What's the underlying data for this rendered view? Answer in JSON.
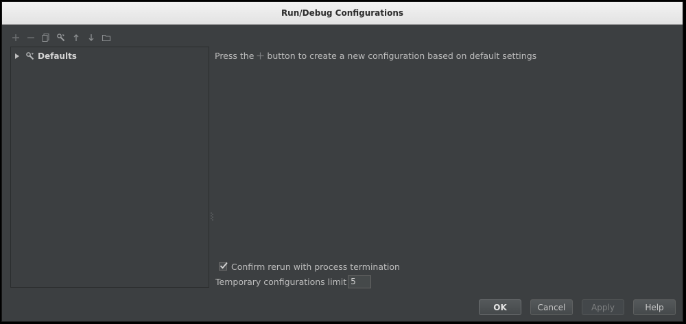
{
  "window": {
    "title": "Run/Debug Configurations"
  },
  "toolbar": {
    "items": [
      {
        "name": "add",
        "icon": "plus-icon"
      },
      {
        "name": "remove",
        "icon": "minus-icon"
      },
      {
        "name": "copy",
        "icon": "copy-icon"
      },
      {
        "name": "edit-defaults",
        "icon": "wrench-icon"
      },
      {
        "name": "move-up",
        "icon": "arrow-up-icon"
      },
      {
        "name": "move-down",
        "icon": "arrow-down-icon"
      },
      {
        "name": "folder",
        "icon": "folder-icon"
      }
    ]
  },
  "tree": {
    "items": [
      {
        "label": "Defaults",
        "icon": "wrench-icon",
        "expanded": false
      }
    ]
  },
  "main": {
    "hint_prefix": "Press the",
    "hint_suffix": "button to create a new configuration based on default settings",
    "confirm_rerun_label": "Confirm rerun with process termination",
    "confirm_rerun_checked": true,
    "temp_limit_label": "Temporary configurations limit",
    "temp_limit_value": "5"
  },
  "buttons": {
    "ok": "OK",
    "cancel": "Cancel",
    "apply": "Apply",
    "help": "Help"
  },
  "colors": {
    "background": "#3c3f41",
    "text": "#bdbdbd",
    "titlebar": "#e8e8e8"
  }
}
